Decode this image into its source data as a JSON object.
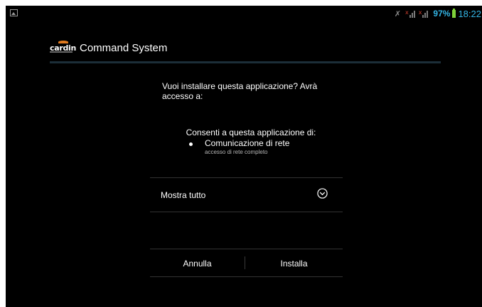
{
  "status_bar": {
    "notification_icon": "image-notification-icon",
    "mute_icon": "mute-icon",
    "signal_icons": [
      "signal-no-service-icon",
      "signal-no-service-icon"
    ],
    "battery_percent": "97%",
    "battery_level": 0.97,
    "clock": "18:22",
    "accent_color": "#33b5e5"
  },
  "app": {
    "logo_text": "cardin",
    "title": "Command System"
  },
  "install": {
    "question": "Vuoi installare questa applicazione? Avrà accesso a:",
    "permissions_header": "Consenti a questa applicazione di:",
    "permissions": [
      {
        "name": "Comunicazione di rete",
        "description": "accesso di rete completo"
      }
    ],
    "show_all_label": "Mostra tutto",
    "cancel_label": "Annulla",
    "install_label": "Installa"
  },
  "colors": {
    "background": "#000000",
    "divider": "#1c2e38",
    "logo_accent": "#e07a1f",
    "battery": "#7fd23a"
  }
}
